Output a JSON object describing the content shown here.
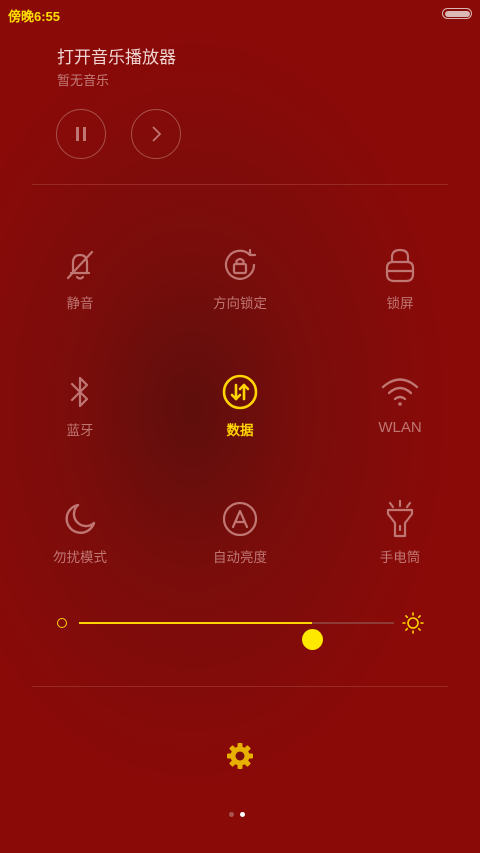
{
  "status_bar": {
    "time": "傍晚6:55"
  },
  "music": {
    "title": "打开音乐播放器",
    "subtitle": "暂无音乐",
    "play_pause_icon": "pause-icon",
    "next_icon": "chevron-right-icon"
  },
  "toggles": [
    {
      "label": "静音",
      "icon": "bell-off-icon",
      "active": false
    },
    {
      "label": "方向锁定",
      "icon": "rotation-lock-icon",
      "active": false
    },
    {
      "label": "锁屏",
      "icon": "lock-icon",
      "active": false
    },
    {
      "label": "蓝牙",
      "icon": "bluetooth-icon",
      "active": false
    },
    {
      "label": "数据",
      "icon": "mobile-data-icon",
      "active": true
    },
    {
      "label": "WLAN",
      "icon": "wifi-icon",
      "active": false
    },
    {
      "label": "勿扰模式",
      "icon": "moon-icon",
      "active": false
    },
    {
      "label": "自动亮度",
      "icon": "auto-brightness-icon",
      "active": false
    },
    {
      "label": "手电筒",
      "icon": "flashlight-icon",
      "active": false
    }
  ],
  "brightness": {
    "level_fraction": 0.74,
    "min_icon": "brightness-low-icon",
    "max_icon": "brightness-high-icon"
  },
  "settings_icon": "gear-icon",
  "pager": {
    "count": 2,
    "current": 2
  },
  "colors": {
    "accent": "#ffd400",
    "background": "#8a0a08",
    "inactive": "#c07672"
  }
}
